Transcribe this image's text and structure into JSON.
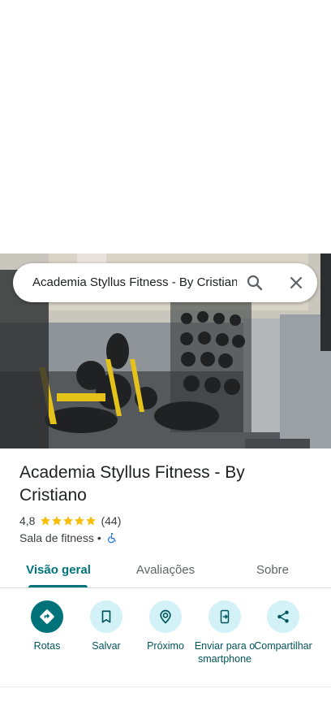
{
  "search": {
    "query": "Academia Styllus Fitness - By Cristiano"
  },
  "place": {
    "name": "Academia Styllus Fitness - By Cristiano",
    "rating": "4,8",
    "stars": 5,
    "review_count": "(44)",
    "category": "Sala de fitness",
    "separator": "•",
    "accessibility_icon": "wheelchair-icon"
  },
  "tabs": [
    {
      "label": "Visão geral",
      "active": true
    },
    {
      "label": "Avaliações",
      "active": false
    },
    {
      "label": "Sobre",
      "active": false
    }
  ],
  "actions": [
    {
      "label": "Rotas",
      "icon": "directions-icon"
    },
    {
      "label": "Salvar",
      "icon": "bookmark-icon"
    },
    {
      "label": "Próximo",
      "icon": "nearby-icon"
    },
    {
      "label": "Enviar para o smartphone",
      "icon": "send-to-phone-icon"
    },
    {
      "label": "Compartilhar",
      "icon": "share-icon"
    }
  ],
  "colors": {
    "accent": "#00737a",
    "action_bg": "#d2f2f8",
    "star": "#fbbc04"
  }
}
